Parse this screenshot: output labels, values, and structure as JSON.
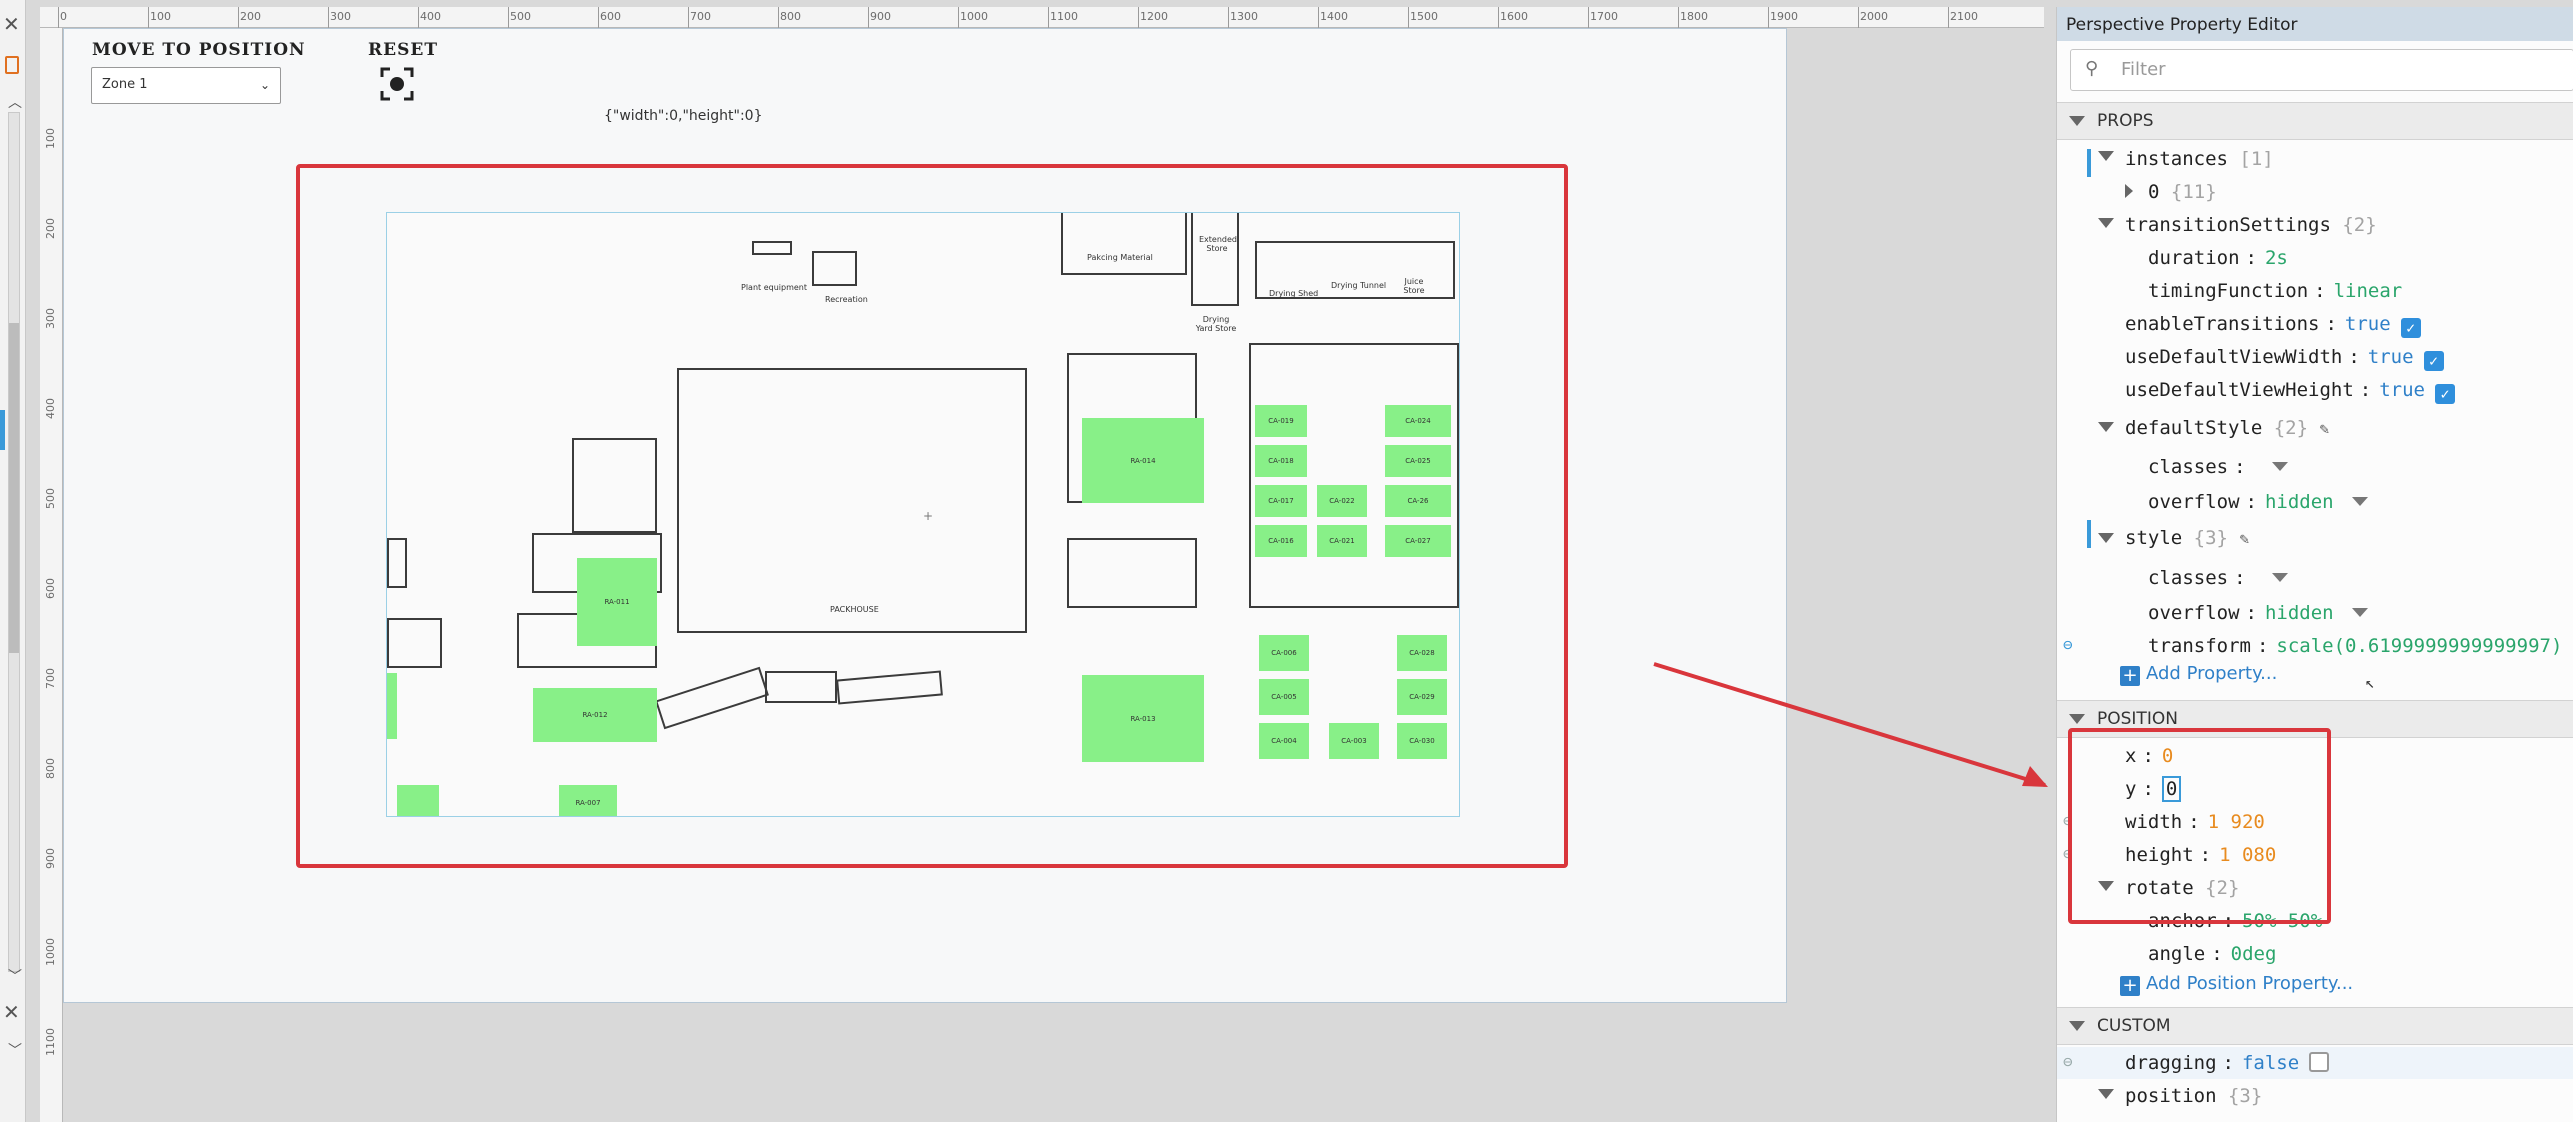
{
  "ruler_h": [
    "0",
    "100",
    "200",
    "300",
    "400",
    "500",
    "600",
    "700",
    "800",
    "900",
    "1000",
    "1100",
    "1200",
    "1300",
    "1400",
    "1500",
    "1600",
    "1700",
    "1800",
    "1900",
    "2000",
    "2100"
  ],
  "ruler_v": [
    "100",
    "200",
    "300",
    "400",
    "500",
    "600",
    "700",
    "800",
    "900",
    "1000",
    "1100"
  ],
  "view": {
    "move_label": "MOVE TO POSITION",
    "reset_label": "RESET",
    "zone_value": "Zone 1",
    "json_text": "{\"width\":0,\"height\":0}"
  },
  "map": {
    "labels": {
      "plant": "Plant equipment",
      "recreation": "Recreation",
      "pakcing": "Pakcing Material",
      "extended": "Extended Store",
      "drying_yard": "Drying Yard Store",
      "drying_shed": "Drying Shed",
      "drying_tunnel": "Drying Tunnel",
      "juice": "Juice Store",
      "packhouse": "PACKHOUSE"
    },
    "zones": {
      "ca019": "CA-019",
      "ca024": "CA-024",
      "ca018": "CA-018",
      "ca025": "CA-025",
      "ca017": "CA-017",
      "ca022": "CA-022",
      "ca26": "CA-26",
      "ca016": "CA-016",
      "ca021": "CA-021",
      "ca027": "CA-027",
      "ra014": "RA-014",
      "ra011": "RA-011",
      "ra012": "RA-012",
      "ra013": "RA-013",
      "ca006": "CA-006",
      "ca028": "CA-028",
      "ca005": "CA-005",
      "ca029": "CA-029",
      "ca004": "CA-004",
      "ca003": "CA-003",
      "ca030": "CA-030",
      "ra007": "RA-007"
    }
  },
  "panel": {
    "title": "Perspective Property Editor",
    "filter_placeholder": "Filter",
    "sections": {
      "props": "PROPS",
      "position": "POSITION",
      "custom": "CUSTOM"
    },
    "props": {
      "instances": "instances",
      "instances_count": "[1]",
      "inst0": "0",
      "inst0_count": "{11}",
      "transition": "transitionSettings",
      "transition_count": "{2}",
      "duration_k": "duration",
      "duration_v": "2s",
      "timing_k": "timingFunction",
      "timing_v": "linear",
      "enable_k": "enableTransitions",
      "enable_v": "true",
      "udvw_k": "useDefaultViewWidth",
      "udvw_v": "true",
      "udvh_k": "useDefaultViewHeight",
      "udvh_v": "true",
      "defstyle": "defaultStyle",
      "defstyle_count": "{2}",
      "classes_k": "classes",
      "overflow_k": "overflow",
      "overflow_v": "hidden",
      "style": "style",
      "style_count": "{3}",
      "transform_k": "transform",
      "transform_v": "scale(0.6199999999999997)",
      "add_prop": "Add Property..."
    },
    "position": {
      "x_k": "x",
      "x_v": "0",
      "y_k": "y",
      "y_v": "0",
      "width_k": "width",
      "width_v": "1 920",
      "height_k": "height",
      "height_v": "1 080",
      "rotate_k": "rotate",
      "rotate_count": "{2}",
      "anchor_k": "anchor",
      "anchor_v": "50% 50%",
      "angle_k": "angle",
      "angle_v": "0deg",
      "add_pos": "Add Position Property..."
    },
    "custom": {
      "dragging_k": "dragging",
      "dragging_v": "false",
      "position_k": "position",
      "position_count": "{3}"
    }
  },
  "colors": {
    "accent": "#2f80c8",
    "string_value": "#2aa56b",
    "number_value": "#e88b1f",
    "annotation_red": "#d9363c",
    "zone_green": "#88f088"
  }
}
